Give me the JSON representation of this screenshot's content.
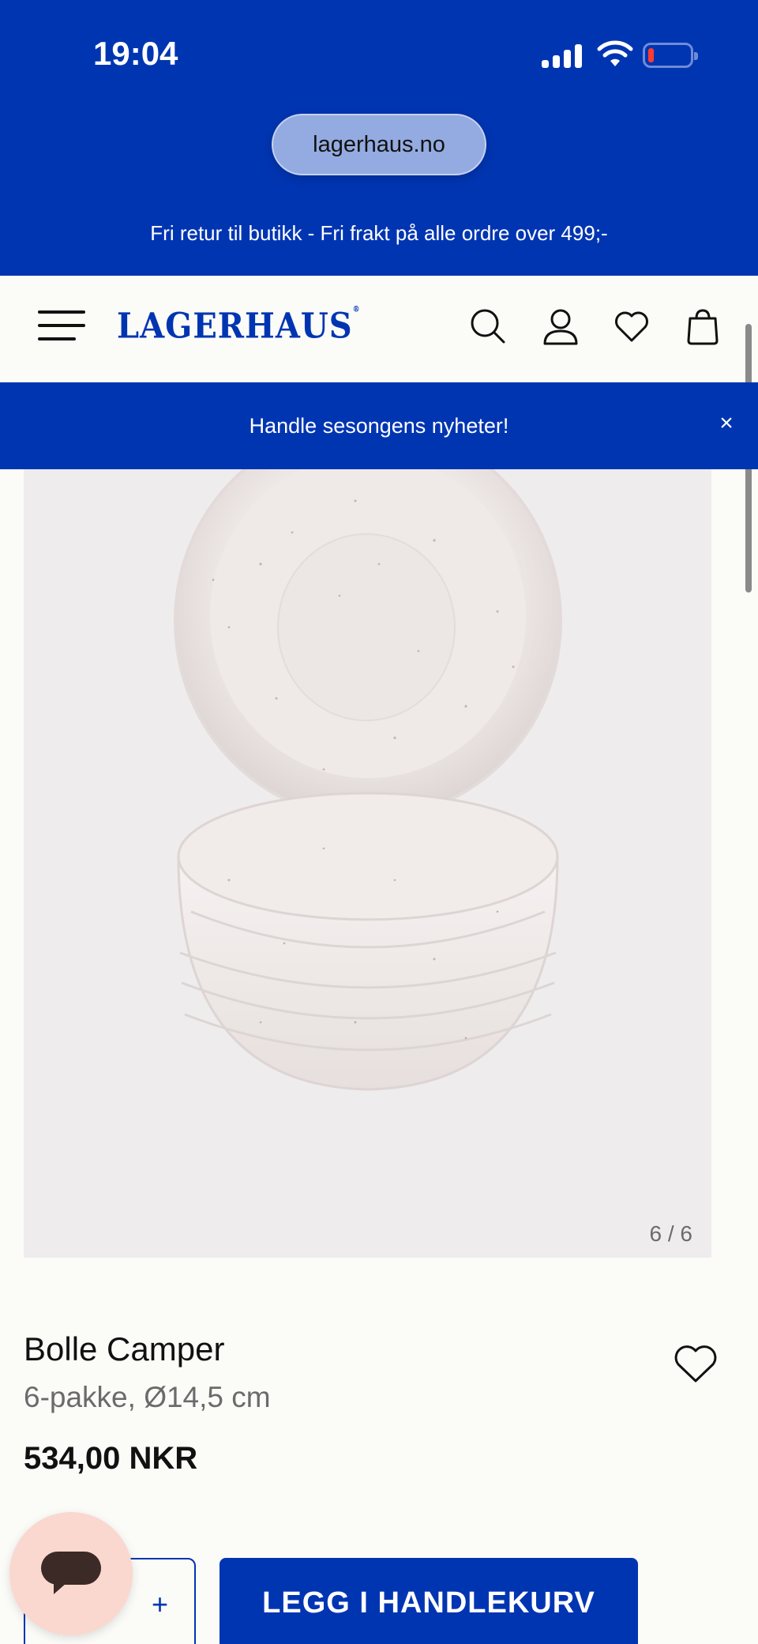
{
  "status_bar": {
    "time": "19:04",
    "icons": [
      "signal-icon",
      "wifi-icon",
      "battery-icon"
    ],
    "battery_color": "#ff3b30"
  },
  "browser": {
    "url": "lagerhaus.no"
  },
  "promo": {
    "text": "Fri retur til butikk - Fri frakt på alle ordre over 499;-"
  },
  "header": {
    "logo": "LAGERHAUS",
    "icons": [
      "menu-icon",
      "search-icon",
      "account-icon",
      "wishlist-icon",
      "cart-icon"
    ]
  },
  "announcement": {
    "text": "Handle sesongens nyheter!",
    "close_symbol": "×"
  },
  "gallery": {
    "counter": "6 / 6"
  },
  "product": {
    "title": "Bolle Camper",
    "subtitle": "6-pakke, Ø14,5 cm",
    "price": "534,00 NKR"
  },
  "actions": {
    "qty_minus": "-",
    "qty_plus": "+",
    "add_to_cart": "LEGG I HANDLEKURV"
  },
  "colors": {
    "brand_blue": "#0035b2",
    "background": "#fbfbf8",
    "chat_bubble": "#fad8cf"
  }
}
